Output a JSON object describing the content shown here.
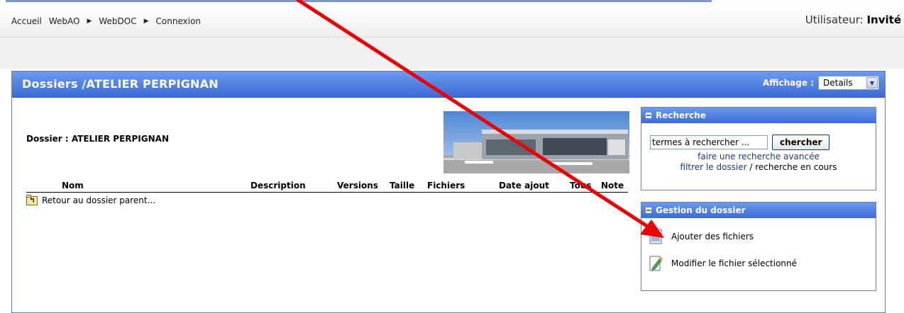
{
  "breadcrumb": {
    "items": [
      "Accueil",
      "WebAO",
      "WebDOC",
      "Connexion"
    ]
  },
  "user": {
    "label": "Utilisateur:",
    "name": "Invité"
  },
  "panel": {
    "title": "Dossiers /ATELIER PERPIGNAN",
    "affichage_label": "Affichage :",
    "affichage_value": "Details"
  },
  "folder": {
    "label": "Dossier : ATELIER PERPIGNAN"
  },
  "table": {
    "columns": [
      "Nom",
      "Description",
      "Versions",
      "Taille",
      "Fichiers",
      "Date ajout",
      "Tous",
      "Note"
    ],
    "rows": [
      {
        "name": "Retour au dossier parent..."
      }
    ]
  },
  "search": {
    "title": "Recherche",
    "input_value": "termes à rechercher ...",
    "button": "chercher",
    "advanced_link": "faire une recherche avancée",
    "filter_link": "filtrer le dossier",
    "filter_sep": " / ",
    "filter_text": "recherche en cours"
  },
  "gestion": {
    "title": "Gestion du dossier",
    "add_files": "Ajouter des fichiers",
    "modify_file": "Modifier le fichier sélectionné"
  },
  "colors": {
    "header_blue": "#3c6bd6",
    "link_blue": "#1c3a8c",
    "arrow_red": "#ee0000"
  },
  "icons": {
    "breadcrumb_separator": "triangle-right-icon",
    "parent_folder": "folder-up-icon",
    "add_files": "add-file-icon",
    "modify_file": "edit-file-icon",
    "collapse": "minus-icon",
    "dropdown": "chevron-down-icon"
  }
}
